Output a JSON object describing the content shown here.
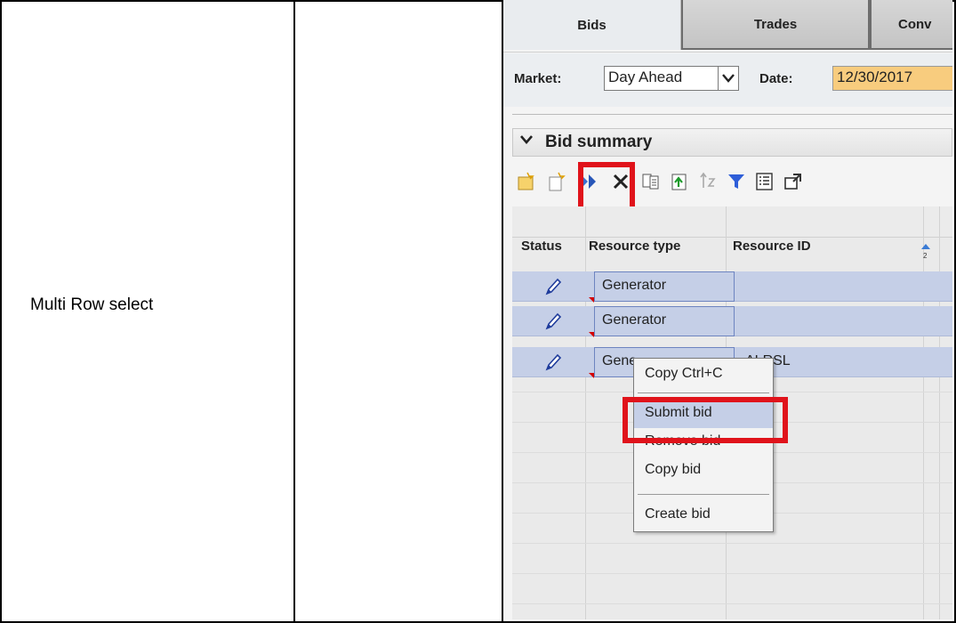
{
  "doc": {
    "row_label": "Multi Row select"
  },
  "tabs": [
    {
      "label": "Bids",
      "active": true
    },
    {
      "label": "Trades",
      "active": false
    },
    {
      "label": "Conv",
      "active": false
    }
  ],
  "filters": {
    "market_label": "Market:",
    "market_value": "Day Ahead",
    "date_label": "Date:",
    "date_value": "12/30/2017"
  },
  "bid_summary": {
    "title": "Bid summary",
    "toolbar_icons": [
      "new-bid-icon",
      "new-bid-copy-icon",
      "submit-icon",
      "delete-icon",
      "copy-icon",
      "upload-icon",
      "sort-icon",
      "filter-icon",
      "column-chooser-icon",
      "popout-icon"
    ],
    "columns": [
      "Status",
      "Resource type",
      "Resource ID"
    ],
    "rows": [
      {
        "status_icon": "pencil-icon",
        "resource_type": "Generator",
        "resource_id": ""
      },
      {
        "status_icon": "pencil-icon",
        "resource_type": "Generator",
        "resource_id": ""
      },
      {
        "status_icon": "pencil-icon",
        "resource_type": "Gene",
        "resource_id": "ALRSL"
      }
    ]
  },
  "context_menu": {
    "copy": "Copy Ctrl+C",
    "submit_bid": "Submit bid",
    "remove_bid": "Remove bid",
    "copy_bid": "Copy bid",
    "create_bid": "Create bid"
  },
  "colors": {
    "selection": "#c5cfe7",
    "highlight": "#e0131b",
    "date_bg": "#f8cc7e"
  }
}
